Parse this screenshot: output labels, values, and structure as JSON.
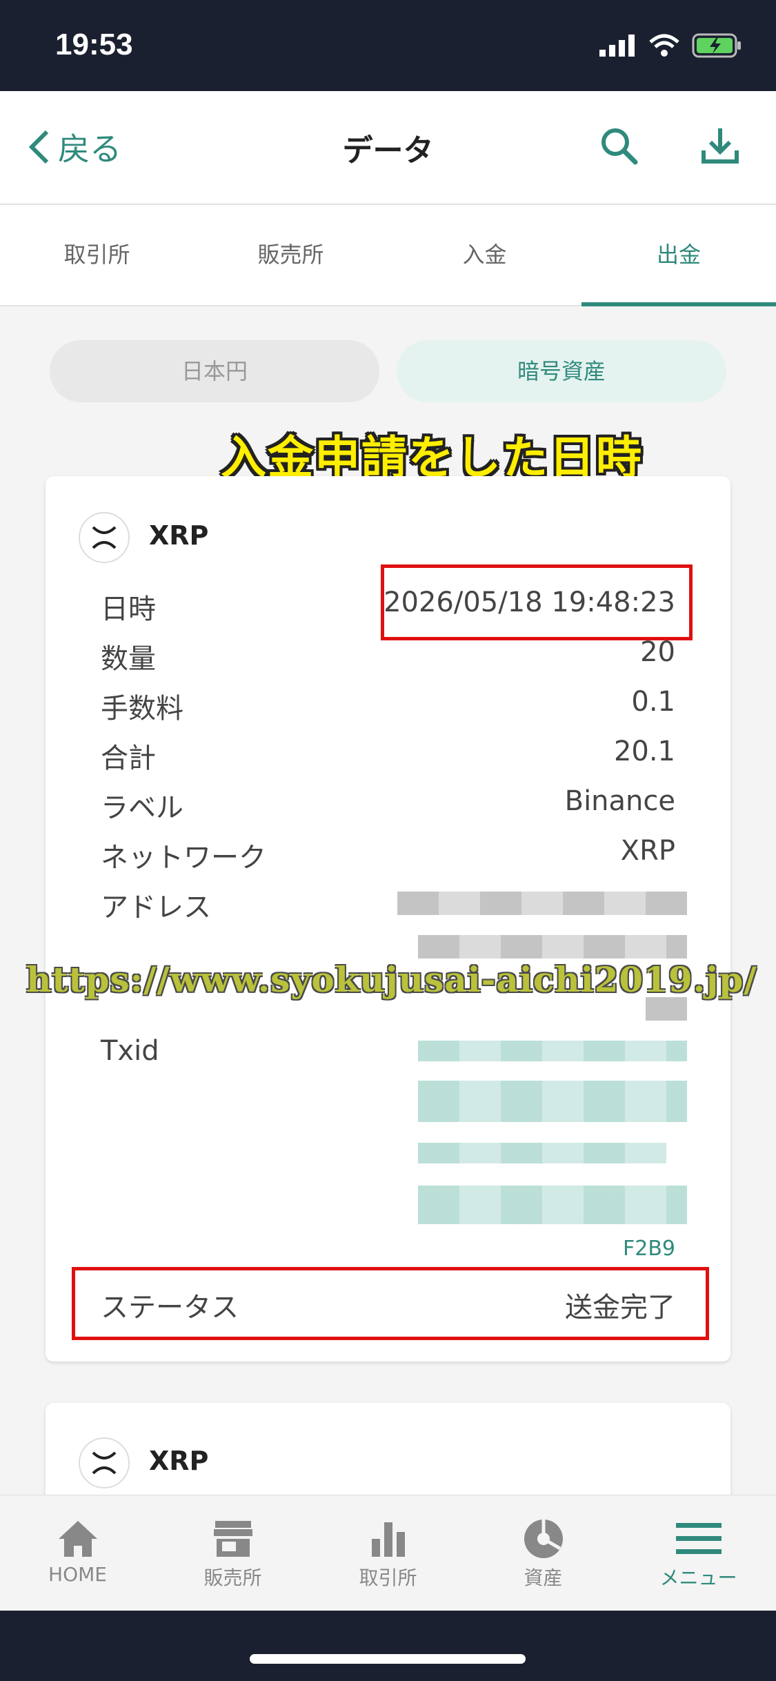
{
  "status": {
    "time": "19:53"
  },
  "nav": {
    "back_label": "戻る",
    "title": "データ"
  },
  "tabs": [
    {
      "label": "取引所",
      "active": false
    },
    {
      "label": "販売所",
      "active": false
    },
    {
      "label": "入金",
      "active": false
    },
    {
      "label": "出金",
      "active": true
    }
  ],
  "segments": {
    "jpy": "日本円",
    "crypto": "暗号資産",
    "selected": "暗号資産"
  },
  "annotation": "入金申請をした日時",
  "watermark": "https://www.syokujusai-aichi2019.jp/",
  "transaction": {
    "coin": "XRP",
    "rows": {
      "datetime_label": "日時",
      "datetime_value": "2026/05/18 19:48:23",
      "amount_label": "数量",
      "amount_value": "20",
      "fee_label": "手数料",
      "fee_value": "0.1",
      "total_label": "合計",
      "total_value": "20.1",
      "label_label": "ラベル",
      "label_value": "Binance",
      "network_label": "ネットワーク",
      "network_value": "XRP",
      "address_label": "アドレス",
      "txid_label": "Txid",
      "txid_tail": "F2B9",
      "status_label": "ステータス",
      "status_value": "送金完了"
    }
  },
  "second_card": {
    "coin": "XRP"
  },
  "bottom_nav": [
    {
      "label": "HOME",
      "icon": "home-icon"
    },
    {
      "label": "販売所",
      "icon": "store-icon"
    },
    {
      "label": "取引所",
      "icon": "bar-chart-icon"
    },
    {
      "label": "資産",
      "icon": "pie-chart-icon"
    },
    {
      "label": "メニュー",
      "icon": "menu-icon",
      "active": true
    }
  ],
  "colors": {
    "accent": "#2f8a7c",
    "highlight": "#e01010",
    "annotation": "#ffee00"
  }
}
